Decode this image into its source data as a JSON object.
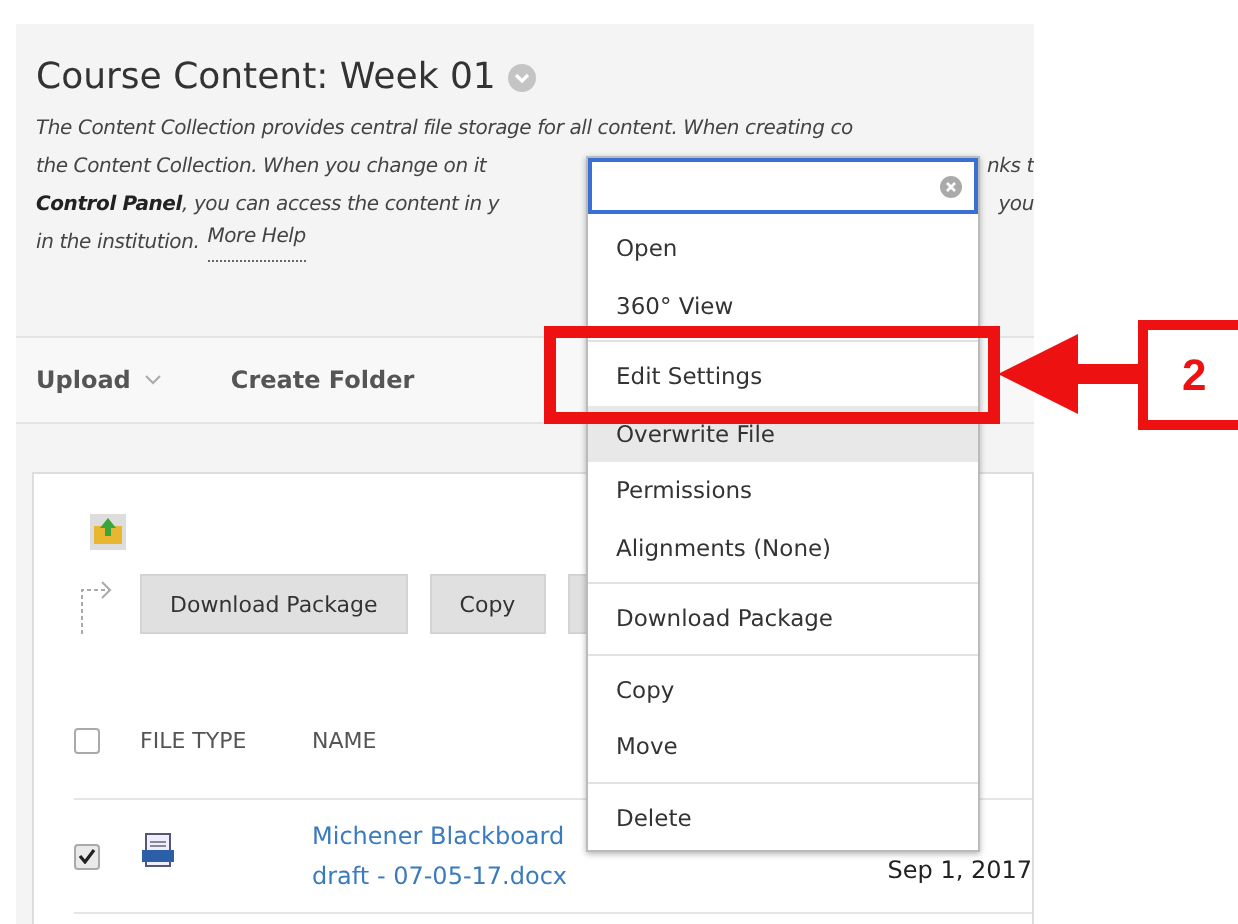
{
  "page": {
    "title": "Course Content: Week 01",
    "description": [
      {
        "left": "The Content Collection provides central file storage for all content. When creating co"
      },
      {
        "left": "the Content Collection. When you change on it",
        "right": "nks t"
      },
      {
        "left": "**Control Panel**, you can access the content in y",
        "right": "you"
      },
      {
        "left": "in the institution.",
        "link": "More Help"
      }
    ]
  },
  "toolbar": [
    {
      "label": "Upload",
      "kind": "menu"
    },
    {
      "label": "Create Folder",
      "kind": "plain"
    }
  ],
  "actions": [
    {
      "kind": "labeled",
      "label": "Download Package"
    },
    {
      "kind": "labeled",
      "label": "Copy"
    },
    {
      "kind": "covered"
    }
  ],
  "table": {
    "columns": [
      "FILE TYPE",
      "NAME"
    ],
    "header_checked": false,
    "rows": [
      {
        "checked": true,
        "name": "Michener Blackboard\ndraft - 07-05-17.docx",
        "date": "Sep 1, 2017"
      }
    ]
  },
  "context_menu": {
    "groups": [
      [
        {
          "label": "Open",
          "highlighted": false
        },
        {
          "label": "360° View",
          "highlighted": false
        }
      ],
      [
        {
          "label": "Edit Settings",
          "highlighted": false
        },
        {
          "label": "Overwrite File",
          "highlighted": true
        },
        {
          "label": "Permissions",
          "highlighted": false
        },
        {
          "label": "Alignments (None)",
          "highlighted": false
        }
      ],
      [
        {
          "label": "Download Package",
          "highlighted": false
        }
      ],
      [
        {
          "label": "Copy",
          "highlighted": false
        },
        {
          "label": "Move",
          "highlighted": false
        }
      ],
      [
        {
          "label": "Delete",
          "highlighted": false
        }
      ]
    ]
  },
  "annotation": {
    "step": "2"
  }
}
